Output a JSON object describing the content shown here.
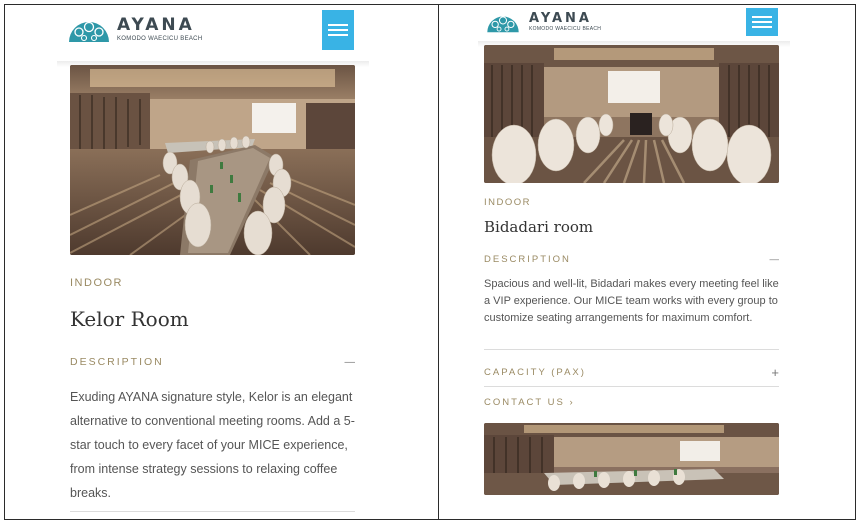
{
  "left": {
    "brand": {
      "name": "AYANA",
      "sub": "KOMODO WAECICU BEACH"
    },
    "room": {
      "category": "INDOOR",
      "title": "Kelor Room",
      "description_label": "DESCRIPTION",
      "description_toggle": "—",
      "description": "Exuding AYANA signature style, Kelor is an elegant alternative to conventional meeting rooms. Add a 5-star touch to every facet of your MICE experience, from intense strategy sessions to relaxing coffee breaks."
    }
  },
  "right": {
    "brand": {
      "name": "AYANA",
      "sub": "KOMODO WAECICU BEACH"
    },
    "room": {
      "category": "INDOOR",
      "title": "Bidadari room",
      "description_label": "DESCRIPTION",
      "description_toggle": "—",
      "description": "Spacious and well-lit, Bidadari makes every meeting feel like a VIP experience. Our MICE team works with every group to customize seating arrangements for maximum comfort.",
      "capacity_label": "CAPACITY (PAX)",
      "capacity_toggle": "+",
      "contact_label": "CONTACT US ›"
    }
  },
  "colors": {
    "accent": "#39b3e5",
    "gold": "#9a8a63",
    "text": "#555555",
    "emblem": "#2e98a8"
  },
  "icons": {
    "menu": "hamburger-icon",
    "logo": "ayana-emblem-icon"
  }
}
